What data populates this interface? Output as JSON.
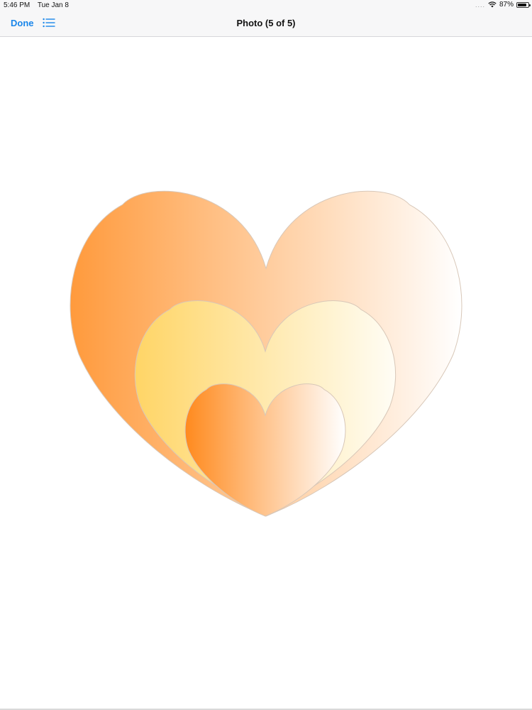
{
  "status_bar": {
    "time": "5:46 PM",
    "date": "Tue Jan 8",
    "battery": "87%",
    "battery_level": 0.87,
    "icons": [
      "cellular-dots-icon",
      "wifi-icon",
      "battery-icon"
    ]
  },
  "nav": {
    "done_label": "Done",
    "title": "Photo (5 of 5)",
    "list_icon": "list-icon"
  },
  "colors": {
    "accent": "#1a86ea",
    "heart_large_start": "#ff9a3c",
    "heart_large_end": "#ffffff",
    "heart_medium_start": "#ffd566",
    "heart_medium_end": "#fffdf5",
    "heart_small_start": "#ff8a1e",
    "heart_small_end": "#ffffff"
  },
  "photo": {
    "content": "three-nested-hearts"
  }
}
